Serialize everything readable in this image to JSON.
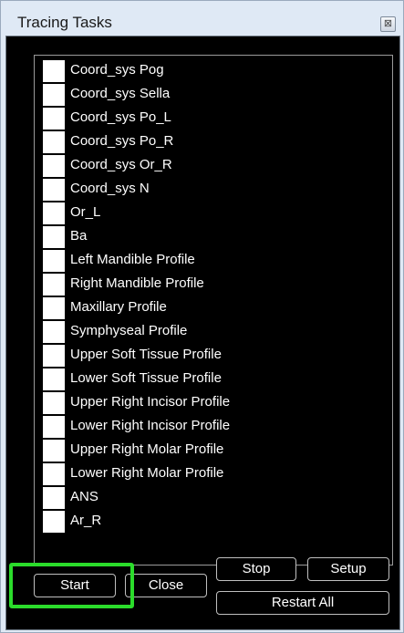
{
  "window": {
    "title": "Tracing Tasks",
    "close_glyph": "⊠"
  },
  "tasks": [
    {
      "label": "Coord_sys Pog",
      "checked": false
    },
    {
      "label": "Coord_sys Sella",
      "checked": false
    },
    {
      "label": "Coord_sys Po_L",
      "checked": false
    },
    {
      "label": "Coord_sys Po_R",
      "checked": false
    },
    {
      "label": "Coord_sys Or_R",
      "checked": false
    },
    {
      "label": "Coord_sys N",
      "checked": false
    },
    {
      "label": "Or_L",
      "checked": false
    },
    {
      "label": "Ba",
      "checked": false
    },
    {
      "label": "Left Mandible Profile",
      "checked": false
    },
    {
      "label": "Right Mandible Profile",
      "checked": false
    },
    {
      "label": "Maxillary Profile",
      "checked": false
    },
    {
      "label": "Symphyseal Profile",
      "checked": false
    },
    {
      "label": "Upper Soft Tissue Profile",
      "checked": false
    },
    {
      "label": "Lower Soft Tissue Profile",
      "checked": false
    },
    {
      "label": "Upper Right Incisor Profile",
      "checked": false
    },
    {
      "label": "Lower Right Incisor Profile",
      "checked": false
    },
    {
      "label": "Upper Right Molar Profile",
      "checked": false
    },
    {
      "label": "Lower Right Molar Profile",
      "checked": false
    },
    {
      "label": "ANS",
      "checked": false
    },
    {
      "label": "Ar_R",
      "checked": false
    }
  ],
  "buttons": {
    "start": "Start",
    "close": "Close",
    "stop": "Stop",
    "setup": "Setup",
    "restart_all": "Restart All"
  },
  "colors": {
    "highlight": "#2bdc2b",
    "panel_background": "#000000",
    "window_chrome": "#dfe9f5"
  }
}
